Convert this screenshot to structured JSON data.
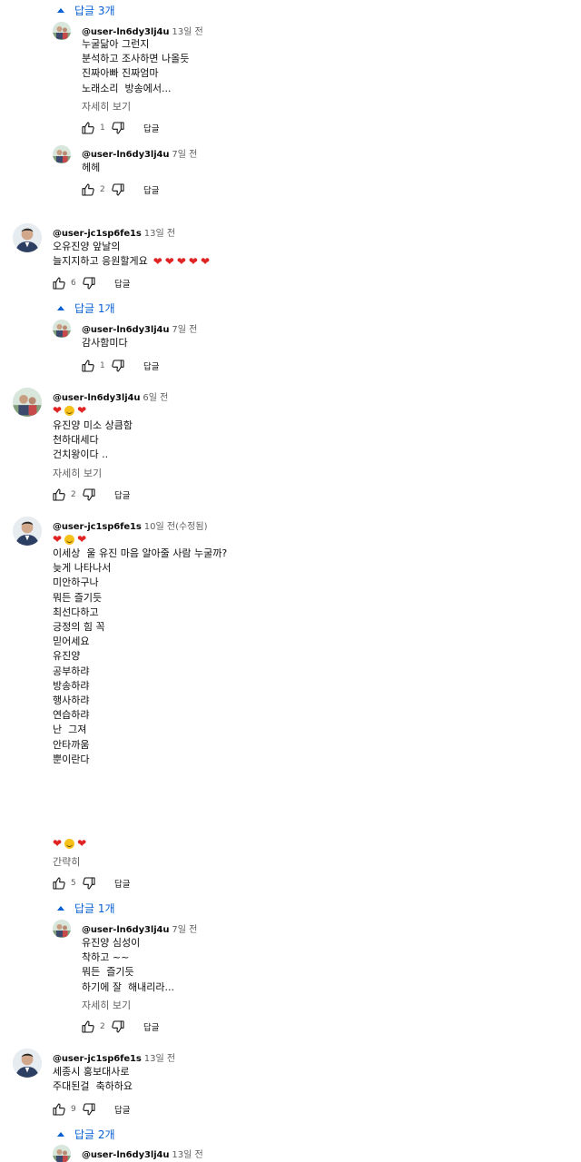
{
  "ui": {
    "reply_label": "답글",
    "show_more": "자세히 보기",
    "show_less": "간략히",
    "colors": {
      "link": "#065fd4",
      "heart": "#e02424",
      "muted": "#606060"
    }
  },
  "comments": [
    {
      "toggle": "답글 3개",
      "author": "@user-ln6dy3lj4u",
      "time": "13일 전",
      "lines": [
        "누굴닮아 그런지",
        "분석하고 조사하면 나올듯",
        "진짜아빠 진짜엄마",
        "노래소리  방송에서..."
      ],
      "more": "자세히 보기",
      "likes": "1"
    },
    {
      "author": "@user-ln6dy3lj4u",
      "time": "7일 전",
      "lines": [
        "헤헤"
      ],
      "likes": "2"
    },
    {
      "author": "@user-jc1sp6fe1s",
      "time": "13일 전",
      "lines": [
        "오유진양 앞날의",
        "늘지지하고 응원할게요"
      ],
      "likes": "6"
    },
    {
      "toggle": "답글 1개",
      "author": "@user-ln6dy3lj4u",
      "time": "7일 전",
      "lines": [
        "감사함미다"
      ],
      "likes": "1"
    },
    {
      "author": "@user-ln6dy3lj4u",
      "time": "6일 전",
      "lines": [
        "유진양 미소 상큼함",
        "천하대세다",
        "건치왕이다 .."
      ],
      "more": "자세히 보기",
      "likes": "2"
    },
    {
      "author": "@user-jc1sp6fe1s",
      "time": "10일 전(수정됨)",
      "lines": [
        "이세상  울 유진 마음 알아줄 사람 누굴까?",
        "",
        "늦게 나타나서",
        "",
        "미안하구나",
        "",
        "뭐든 즐기듯",
        "최선다하고",
        "긍정의 힘 꼭",
        "믿어세요",
        "",
        "유진양",
        "공부하랴",
        "방송하랴",
        "행사하랴",
        "연습하랴",
        "",
        "난  그져",
        "안타까움",
        "뿐이란다"
      ],
      "more": "간략히",
      "likes": "5"
    },
    {
      "toggle": "답글 1개",
      "author": "@user-ln6dy3lj4u",
      "time": "7일 전",
      "lines": [
        "유진양 심성이",
        "착하고 ~~",
        "뭐든  즐기듯",
        "하기에 잘  해내리라..."
      ],
      "more": "자세히 보기",
      "likes": "2"
    },
    {
      "author": "@user-jc1sp6fe1s",
      "time": "13일 전",
      "lines": [
        "세종시 홍보대사로",
        "주대된걸  축하하요"
      ],
      "likes": "9"
    },
    {
      "toggle": "답글 2개",
      "author": "@user-ln6dy3lj4u",
      "time": "13일 전"
    }
  ],
  "icons": [
    "caret-up-icon",
    "thumbs-up-icon",
    "thumbs-down-icon",
    "heart-icon",
    "grinning-face-icon",
    "user-avatar"
  ]
}
